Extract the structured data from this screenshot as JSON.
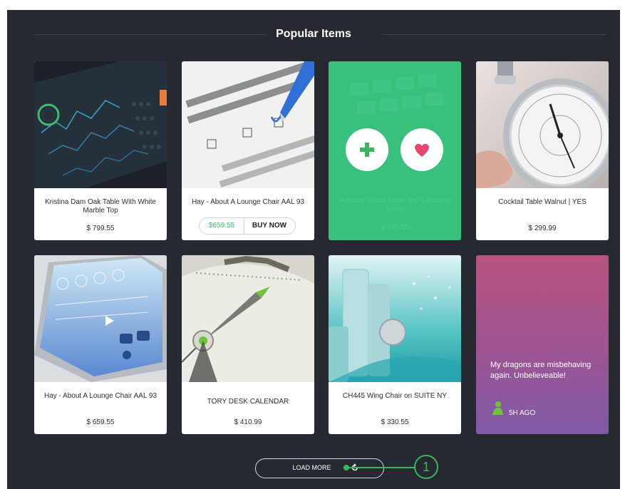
{
  "section": {
    "title": "Popular Items"
  },
  "products": [
    {
      "name": "Kristina Dam Oak Table With White Marble Top",
      "price": "$ 799.55"
    },
    {
      "name": "Hay - About A Lounge Chair AAL 93",
      "price": "$659.55",
      "action": "BUY NOW"
    },
    {
      "name": "Activate Facial Mask and Charcoal Soap",
      "price": "$ 129.55"
    },
    {
      "name": "Cocktail Table Walnut | YES",
      "price": "$ 299.99"
    },
    {
      "name": "Hay - About A Lounge Chair AAL 93",
      "price": "$ 659.55"
    },
    {
      "name": "TORY DESK CALENDAR",
      "price": "$ 410.99"
    },
    {
      "name": "CH445 Wing Chair on SUITE NY",
      "price": "$ 330.55"
    }
  ],
  "message_card": {
    "text": "My dragons are misbehaving again. Unbelieveable!",
    "time": "5H AGO"
  },
  "load_more": {
    "label": "LOAD MORE"
  },
  "callout": {
    "number": "1"
  },
  "icons": {
    "add": "plus-icon",
    "favorite": "heart-icon",
    "refresh": "refresh-icon",
    "user": "user-icon"
  },
  "colors": {
    "background": "#262a30",
    "accent": "#3bb55f",
    "heart": "#e8446c"
  }
}
